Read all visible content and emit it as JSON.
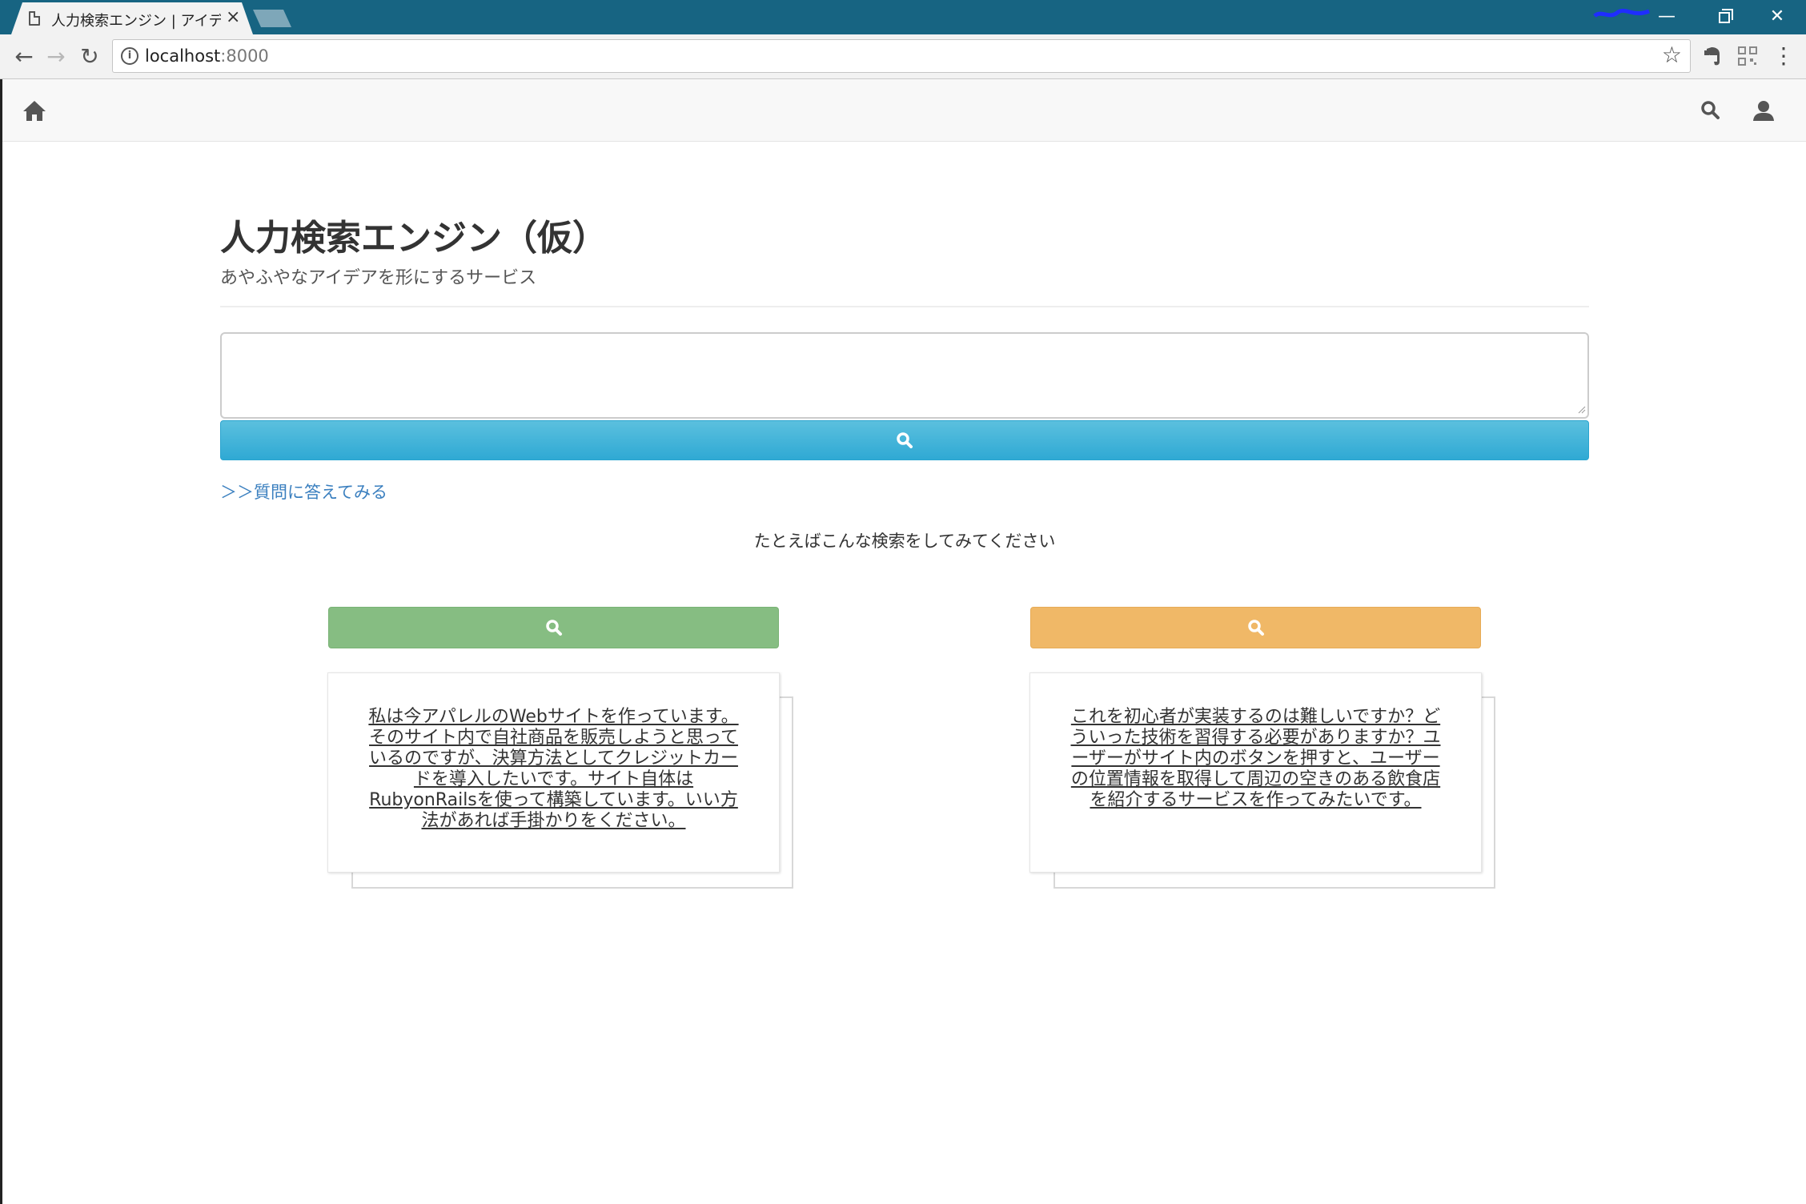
{
  "browser": {
    "tab_title": "人力検索エンジン | アイディア",
    "tab_close": "×",
    "url_host": "localhost",
    "url_port": ":8000",
    "window_controls": {
      "minimize": "—",
      "close": "✕"
    },
    "icons": [
      "page-icon",
      "back-arrow-icon",
      "forward-arrow-icon",
      "reload-icon",
      "info-icon",
      "star-icon",
      "evernote-icon",
      "qr-code-icon",
      "menu-dots-icon"
    ]
  },
  "navbar": {
    "icons": [
      "home-icon",
      "search-icon",
      "user-icon"
    ]
  },
  "header": {
    "title": "人力検索エンジン（仮）",
    "subtitle": "あやふやなアイデアを形にするサービス"
  },
  "search": {
    "query_value": "",
    "button_icon": "search-icon",
    "color": "#5bc0de"
  },
  "links": {
    "answer": "＞＞質問に答えてみる"
  },
  "examples": {
    "heading": "たとえばこんな検索をしてみてください",
    "items": [
      {
        "button_icon": "search-icon",
        "color": "#86bd82",
        "text": "私は今アパレルのWebサイトを作っています。そのサイト内で自社商品を販売しようと思っているのですが、決算方法としてクレジットカードを導入したいです。サイト自体はRubyonRailsを使って構築しています。いい方法があれば手掛かりをください。"
      },
      {
        "button_icon": "search-icon",
        "color": "#f0b867",
        "text": "これを初心者が実装するのは難しいですか？どういった技術を習得する必要がありますか？ユーザーがサイト内のボタンを押すと、ユーザーの位置情報を取得して周辺の空きのある飲食店を紹介するサービスを作ってみたいです。"
      }
    ]
  }
}
